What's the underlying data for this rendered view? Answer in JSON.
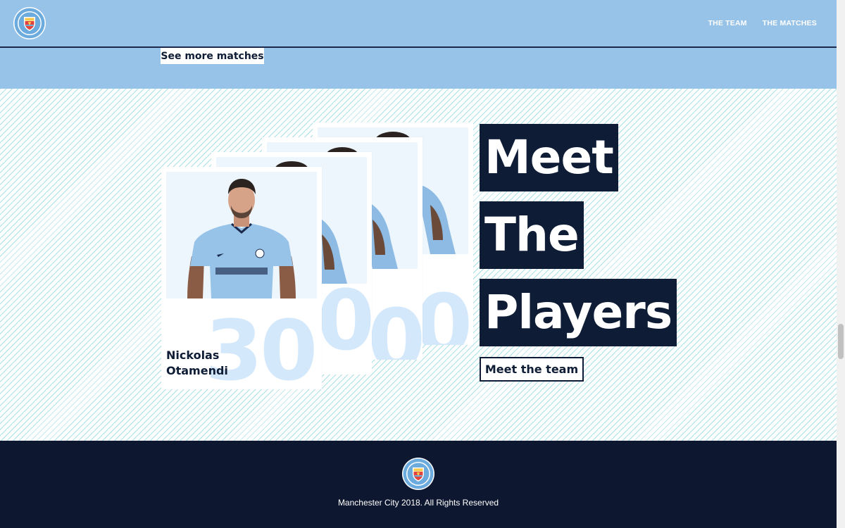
{
  "brand": {
    "logo_icon": "manchester-city-crest-icon"
  },
  "nav": {
    "items": [
      {
        "label": "THE TEAM"
      },
      {
        "label": "THE MATCHES"
      }
    ]
  },
  "matches": {
    "see_more_label": "See more matches"
  },
  "players": {
    "cards": [
      {
        "number": "0"
      },
      {
        "number": "0"
      },
      {
        "number": "0"
      },
      {
        "number": "30",
        "name": "Nickolas Otamendi"
      }
    ],
    "heading_words": [
      "Meet",
      "The",
      "Players"
    ],
    "cta_label": "Meet the team"
  },
  "footer": {
    "copyright": "Manchester City 2018. All Rights Reserved"
  },
  "colors": {
    "sky_blue": "#97c3e9",
    "navy": "#0e1c36",
    "number_tint": "#d3e8fb"
  }
}
